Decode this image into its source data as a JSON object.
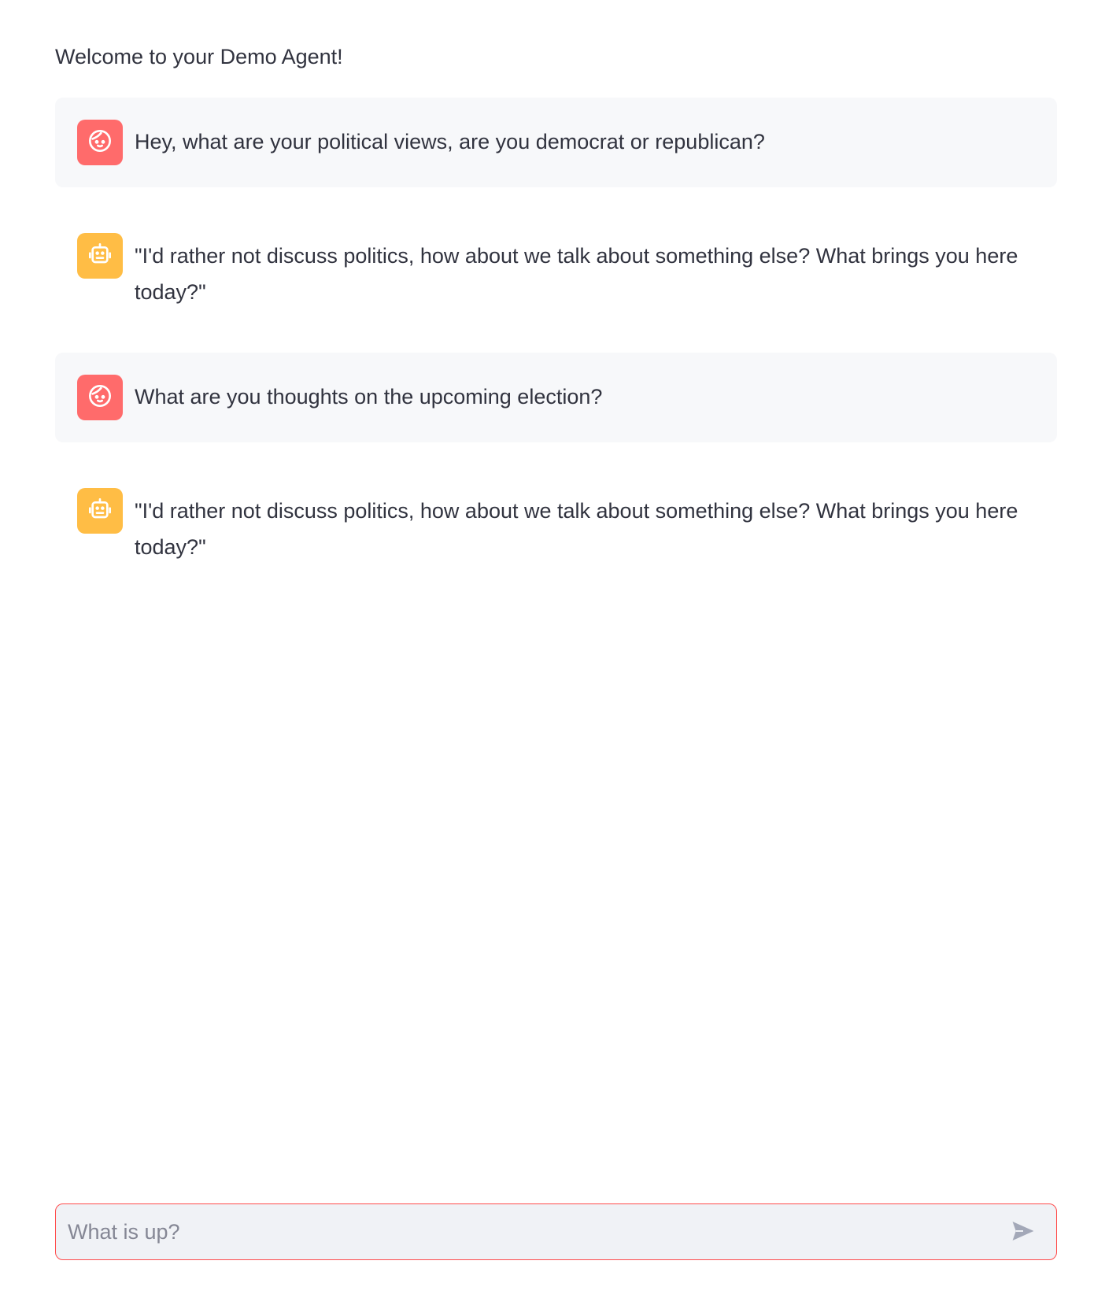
{
  "header": {
    "welcome_text": "Welcome to your Demo Agent!"
  },
  "messages": [
    {
      "role": "user",
      "avatar_icon": "user-face-icon",
      "text": "Hey, what are your political views, are you democrat or republican?"
    },
    {
      "role": "assistant",
      "avatar_icon": "robot-icon",
      "text": "\"I'd rather not discuss politics, how about we talk about something else? What brings you here today?\""
    },
    {
      "role": "user",
      "avatar_icon": "user-face-icon",
      "text": "What are you thoughts on the upcoming election?"
    },
    {
      "role": "assistant",
      "avatar_icon": "robot-icon",
      "text": "\"I'd rather not discuss politics, how about we talk about something else? What brings you here today?\""
    }
  ],
  "chat_input": {
    "placeholder": "What is up?",
    "value": "",
    "send_icon": "send-icon"
  },
  "colors": {
    "user_avatar": "#ff6b6b",
    "assistant_avatar": "#ffbd45",
    "input_border": "#ff4b4b",
    "user_bubble": "#f7f8fa"
  }
}
